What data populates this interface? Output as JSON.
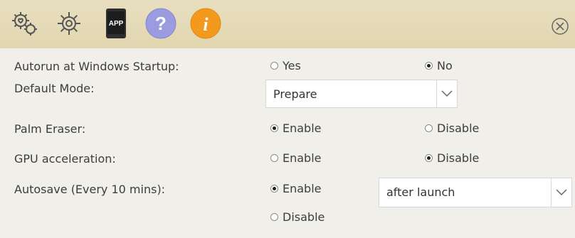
{
  "toolbar": {
    "icons": [
      "gears-heart-icon",
      "gear-icon",
      "app-icon",
      "help-icon",
      "info-icon"
    ],
    "app_badge": "APP",
    "help_glyph": "?",
    "info_glyph": "i",
    "colors": {
      "help": "#9b9be0",
      "info": "#f39a1e",
      "bar": "#e5dab8"
    }
  },
  "settings": {
    "autorun": {
      "label": "Autorun at Windows Startup:",
      "options": [
        "Yes",
        "No"
      ],
      "selected": "No"
    },
    "default_mode": {
      "label": "Default Mode:",
      "value": "Prepare"
    },
    "palm_eraser": {
      "label": "Palm Eraser:",
      "options": [
        "Enable",
        "Disable"
      ],
      "selected": "Enable"
    },
    "gpu": {
      "label": "GPU acceleration:",
      "options": [
        "Enable",
        "Disable"
      ],
      "selected": "Disable"
    },
    "autosave": {
      "label": "Autosave (Every 10 mins):",
      "options": [
        "Enable",
        "Disable"
      ],
      "selected": "Enable",
      "when": "after launch"
    }
  }
}
